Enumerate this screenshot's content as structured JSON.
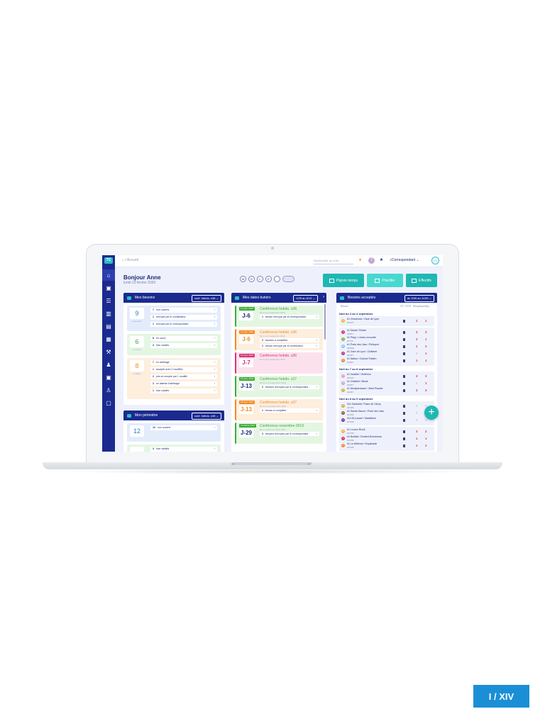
{
  "topbar": {
    "breadcrumb": "⌂ / Accueil",
    "search_placeholder": "Rechercher un chef",
    "role": "Correspondant",
    "avatar_initials": "CG"
  },
  "greeting": {
    "title": "Bonjour Anne",
    "date": "lundi 23 février 2020"
  },
  "filters": [
    "M",
    "D",
    "L",
    "E"
  ],
  "actions": [
    {
      "label": "Pigiste temps",
      "color": "#1fb8b2"
    },
    {
      "label": "Planifier",
      "color": "#47d8cf"
    },
    {
      "label": "Effectifs",
      "color": "#1fb8b2"
    }
  ],
  "needs_panel": {
    "title": "Mes besoins",
    "select": "conf. hebdo. s36",
    "cards": [
      {
        "number": "9",
        "sub": "à pourvoir",
        "color": "#e3ecfb",
        "numcolor": "#2e7fd8",
        "rows": [
          {
            "n": "7",
            "label": "non ouverts"
          },
          {
            "n": "1",
            "label": "renvoyé par le contributeur"
          },
          {
            "n": "1",
            "label": "renvoyé par le correspondant"
          }
        ]
      },
      {
        "number": "6",
        "sub": "en cours",
        "color": "#e4f6e2",
        "numcolor": "#3daa3a",
        "rows": [
          {
            "n": "6",
            "label": "en cours"
          },
          {
            "n": "3",
            "label": "Non validés"
          }
        ]
      },
      {
        "number": "8",
        "sub": "à valider",
        "color": "#fdeedd",
        "numcolor": "#f08a24",
        "rows": [
          {
            "n": "7",
            "label": "en arbitrage"
          },
          {
            "n": "1",
            "label": "accepté avec 2 modifiés"
          },
          {
            "n": "2",
            "label": "pris en compte par 1 modifié"
          },
          {
            "n": "2",
            "label": "en attente d'arbitrage"
          },
          {
            "n": "1",
            "label": "Non validés"
          }
        ]
      }
    ]
  },
  "perimeter_panel": {
    "title": "Mon périmètre",
    "select": "conf. hebdo. s36",
    "cards": [
      {
        "number": "12",
        "sub": "",
        "color": "#e3ecfb",
        "numcolor": "#2e7fd8",
        "rows": [
          {
            "n": "12",
            "label": "non ouverts"
          }
        ]
      },
      {
        "number": "",
        "sub": "",
        "color": "#e4f6e2",
        "numcolor": "#3daa3a",
        "rows": [
          {
            "n": "3",
            "label": "Non validés"
          }
        ]
      }
    ]
  },
  "dates_panel": {
    "title": "Mes dates butoirs",
    "select": "1/09 au 6/12",
    "cards": [
      {
        "badge": "11 sept. 2019",
        "j": "J-6",
        "title": "Conférence hebdo. s36",
        "sub": "Du 2 au 6 septembre 2019",
        "color": "#e4f6e2",
        "accent": "#3daa3a",
        "rows": [
          {
            "n": "1",
            "label": "besoin renvoyé par le correspondant"
          }
        ]
      },
      {
        "badge": "11 sept. 2019",
        "j": "J-6",
        "title": "Conférence hebdo. s36",
        "sub": "Du 2 au 6 septembre 2019",
        "color": "#fdeedd",
        "accent": "#f08a24",
        "rows": [
          {
            "n": "2",
            "label": "besoins à compléter"
          },
          {
            "n": "1",
            "label": "besoin renvoyé par le contributeur"
          }
        ]
      },
      {
        "badge": "12 sept. 2019",
        "j": "J-7",
        "title": "Conférence hebdo. s36",
        "sub": "Du 2 au 6 septembre 2019",
        "color": "#fbe1ec",
        "accent": "#d8317a",
        "rows": []
      },
      {
        "badge": "18 sept. 2019",
        "j": "J-13",
        "title": "Conférence hebdo. s37",
        "sub": "Du 9 au 13 septembre 2019",
        "color": "#e4f6e2",
        "accent": "#3daa3a",
        "rows": [
          {
            "n": "2",
            "label": "besoins renvoyés par le correspondant"
          }
        ]
      },
      {
        "badge": "18 sept. 2019",
        "j": "J-13",
        "title": "Conférence hebdo. s37",
        "sub": "Du 9 au 13 septembre 2019",
        "color": "#fdeedd",
        "accent": "#f08a24",
        "rows": [
          {
            "n": "1",
            "label": "besoin à compléter"
          }
        ]
      },
      {
        "badge": "4 octobre 2019",
        "j": "J-29",
        "title": "Conférence novembre 2019",
        "sub": "Du 1 au 30 novembre 2019",
        "color": "#e4f6e2",
        "accent": "#3daa3a",
        "rows": [
          {
            "n": "3",
            "label": "besoins renvoyés par le correspondant"
          }
        ]
      }
    ]
  },
  "accepted_panel": {
    "title": "Besoins acceptés",
    "select": "du 3/09 au 11/09",
    "col_besoin": "Besoin",
    "col_ot": "OT / OTS",
    "col_rem": "Remplaçant(s)",
    "weeks": [
      {
        "label": "Nuit du 3 au 4 septembre",
        "groups": [
          [
            {
              "line": "1",
              "dot": "#f5b82e",
              "name": "#1 Vincennes / Gare de Lyon",
              "sub": "#1HOT",
              "v1": "1",
              "v2": "1"
            }
          ],
          [
            {
              "line": "2",
              "dot": "#d8317a",
              "name": "#1 Dauat / Roche",
              "sub": "#2MTL",
              "v1": "3",
              "v2": "3"
            },
            {
              "line": "3",
              "dot": "#8ab33a",
              "name": "#1 Pepp / Limes Lecourbe",
              "sub": "#2TOL",
              "v1": "2",
              "v2": "1"
            },
            {
              "line": "3b",
              "dot": "#7ec7e8",
              "name": "#1 Porte des Lilas / Pelleport",
              "sub": "#2MDE",
              "v1": "1",
              "v2": "2"
            },
            {
              "line": "4",
              "dot": "#b43a8c",
              "name": "#1 Gare de Lyon / Châtelet",
              "sub": "#2ABT",
              "v1": "0",
              "v2": "1"
            },
            {
              "line": "5",
              "dot": "#f08a24",
              "name": "#1 Nation / Colonel Fabien",
              "sub": "#2ABT",
              "v1": "1",
              "v2": "1"
            }
          ]
        ]
      },
      {
        "label": "Nuit du 7 au 8 septembre",
        "groups": [
          [
            {
              "line": "7",
              "dot": "#e7a0c2",
              "name": "#1 Invalide / Solférino",
              "sub": "#2OPE",
              "v1": "3",
              "v2": "3"
            },
            {
              "line": "8",
              "dot": "#c7a5d3",
              "name": "#1 Châtelet / Bivaé",
              "sub": "#2ABT",
              "v1": "0",
              "v2": "1"
            },
            {
              "line": "9",
              "dot": "#c9b73a",
              "name": "#1 Montparnasse / Saint Placide",
              "sub": "#2ABT",
              "v1": "3",
              "v2": "3"
            }
          ]
        ]
      },
      {
        "label": "Nuit du 8 au 9 septembre",
        "groups": [
          [
            {
              "line": "10",
              "dot": "#d7a83a",
              "name": "#11 Garibaldi / Place de Clichy",
              "sub": "#1OPE",
              "v1": "0",
              "v2": "0"
            },
            {
              "line": "11",
              "dot": "#8a5a2e",
              "name": "#1 Sainte-Sauve / Porte des Lilas",
              "sub": "#2OPE",
              "v1": "0",
              "v2": "0"
            },
            {
              "line": "14",
              "dot": "#6a2e8c",
              "name": "#14 St-Lazare / Madeleine",
              "sub": "#1OPE",
              "v1": "0",
              "v2": "0"
            }
          ],
          [
            {
              "line": "1",
              "dot": "#f5b82e",
              "name": "#1 Louvre-Rivoli",
              "sub": "#1OPE",
              "v1": "3",
              "v2": "2"
            },
            {
              "line": "2",
              "dot": "#d8317a",
              "name": "#1 Bobillot / Denfert-Rochereau",
              "sub": "#1OPE",
              "v1": "1",
              "v2": "1"
            },
            {
              "line": "5",
              "dot": "#f08a24",
              "name": "#1 La Défense / Esplanade",
              "sub": "#1OPE",
              "v1": "1",
              "v2": "1"
            }
          ]
        ]
      }
    ]
  },
  "page_badge": "I / XIV",
  "fab_label": "+"
}
